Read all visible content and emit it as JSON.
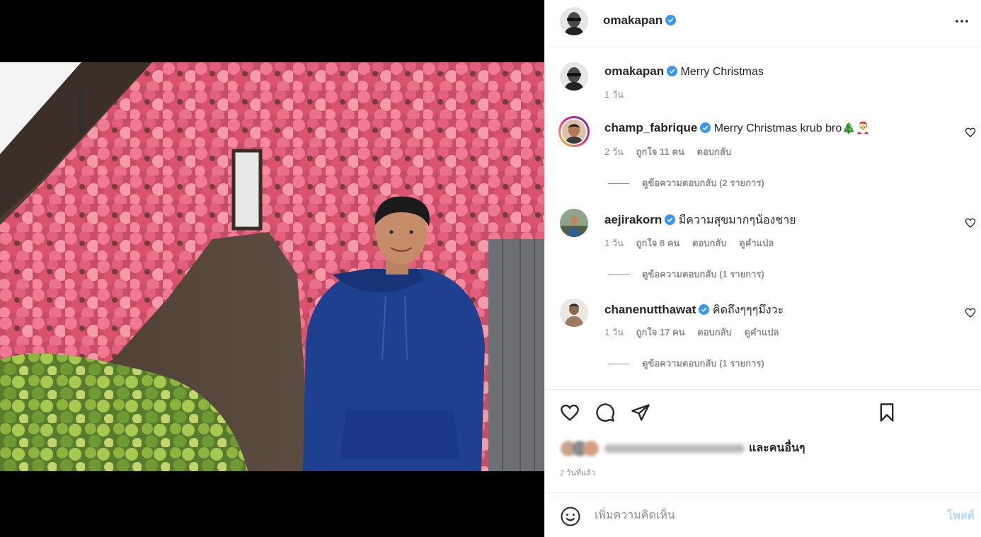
{
  "post": {
    "author": "omakapan",
    "caption": "Merry Christmas",
    "caption_time": "1 วัน",
    "posted_ago": "2 วันที่แล้ว"
  },
  "comments": [
    {
      "user": "champ_fabrique",
      "text": "Merry Christmas krub bro🎄🎅",
      "time": "2 วัน",
      "likes": "ถูกใจ 11 คน",
      "reply": "ตอบกลับ",
      "translate": "",
      "view_replies": "ดูข้อความตอบกลับ (2 รายการ)"
    },
    {
      "user": "aejirakorn",
      "text": "มีความสุขมากๆน้องชาย",
      "time": "1 วัน",
      "likes": "ถูกใจ 8 คน",
      "reply": "ตอบกลับ",
      "translate": "ดูคำแปล",
      "view_replies": "ดูข้อความตอบกลับ (1 รายการ)"
    },
    {
      "user": "chanenutthawat",
      "text": "คิดถึงๆๆๆมึงวะ",
      "time": "1 วัน",
      "likes": "ถูกใจ 17 คน",
      "reply": "ตอบกลับ",
      "translate": "ดูคำแปล",
      "view_replies": "ดูข้อความตอบกลับ (1 รายการ)"
    }
  ],
  "likes_summary": {
    "others_label": "และคนอื่นๆ"
  },
  "compose": {
    "placeholder": "เพิ่มความคิดเห็น",
    "post_label": "โพสต์"
  },
  "icons": {
    "verified": "verified-badge-icon",
    "more": "more-options-icon",
    "like": "heart-icon",
    "comment": "comment-bubble-icon",
    "share": "paper-plane-icon",
    "save": "bookmark-icon",
    "emoji": "smiley-icon"
  },
  "colors": {
    "verified_blue": "#3897f0",
    "muted_text": "#8e8e8e",
    "post_button_disabled": "#b3dbff"
  }
}
